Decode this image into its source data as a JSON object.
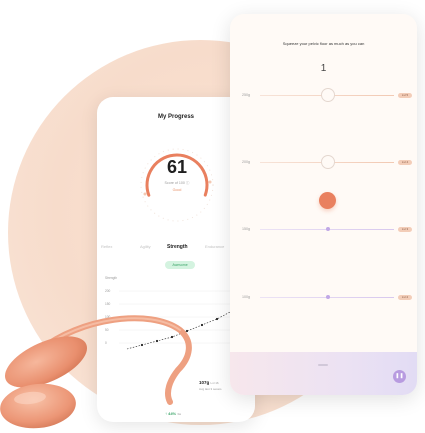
{
  "progress": {
    "title": "My Progress",
    "score": "61",
    "score_sub": "Score of 100 ⓘ",
    "score_status": "Good",
    "score_value": 61,
    "score_max": 100,
    "tabs": [
      "Reflex",
      "Agility",
      "Strength",
      "Endurance"
    ],
    "active_tab": "Strength",
    "badge": "Awesome",
    "chart_axis_title": "Strength",
    "chart_ticks": [
      "200",
      "150",
      "100",
      "50",
      "0"
    ],
    "footer_value": "107g",
    "footer_unit": "Lvl 16",
    "footer_sub": "Avg last 3 sessio",
    "footer_delta": "↑ 44%",
    "footer_delta_sub": "3w"
  },
  "exercise": {
    "instruction": "Squeeze your pelvic floor as much as you can",
    "count": "1",
    "rows": [
      {
        "weight": "250g",
        "level": "Lvl 5"
      },
      {
        "weight": "200g",
        "level": "Lvl 4"
      },
      {
        "weight": "150g",
        "level": "Lvl 3"
      },
      {
        "weight": "100g",
        "level": "Lvl 2"
      }
    ],
    "pause_icon": "pause-icon"
  },
  "colors": {
    "accent": "#e9805f",
    "blob": "#f8dfcf",
    "good_green": "#3da56a",
    "lilac": "#b89be0"
  }
}
